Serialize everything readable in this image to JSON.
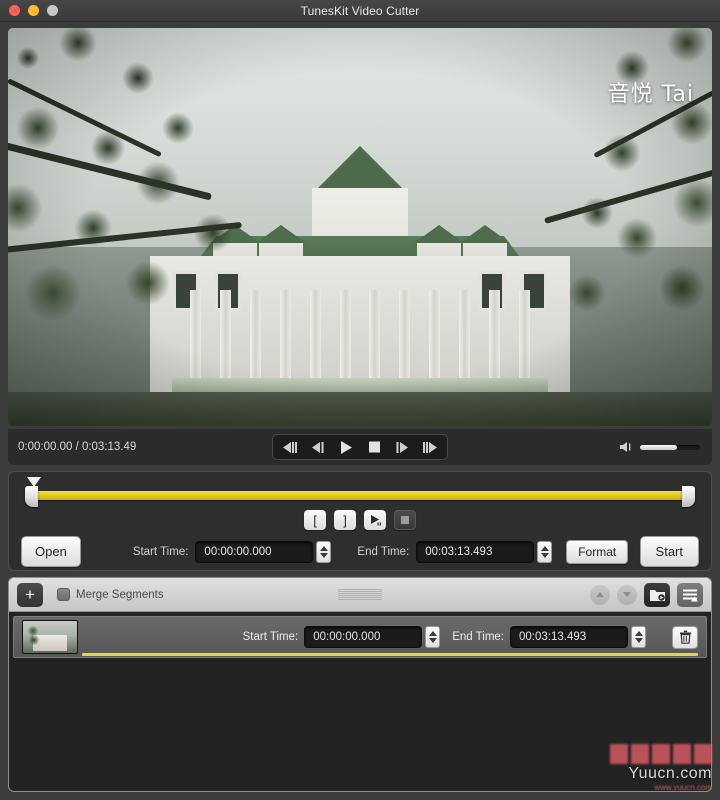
{
  "window": {
    "title": "TunesKit Video Cutter",
    "traffic_lights": [
      "close",
      "minimize",
      "zoom"
    ]
  },
  "video": {
    "watermark_logo": "音悦 Tai",
    "scene_description": "white clock-tower building framed by trees"
  },
  "player": {
    "time_readout": "0:00:00.00 / 0:03:13.49",
    "current_time": "0:00:00.00",
    "total_duration": "0:03:13.49",
    "transport": [
      {
        "name": "step-back-fast-button",
        "icon": "prev-frames-icon"
      },
      {
        "name": "step-back-button",
        "icon": "prev-frame-icon"
      },
      {
        "name": "play-button",
        "icon": "play-icon"
      },
      {
        "name": "stop-button",
        "icon": "stop-icon"
      },
      {
        "name": "step-forward-button",
        "icon": "next-frame-icon"
      },
      {
        "name": "step-forward-fast-button",
        "icon": "next-frames-icon"
      }
    ],
    "volume": {
      "icon": "volume-icon",
      "level_percent": 62
    }
  },
  "trim": {
    "playhead_position_percent": 0,
    "selection_start_percent": 0,
    "selection_end_percent": 100,
    "bar_color": "#e8cf1e",
    "mark_buttons": [
      {
        "name": "mark-in-button",
        "label": "["
      },
      {
        "name": "mark-out-button",
        "label": "]"
      },
      {
        "name": "preview-play-button",
        "label": "▶"
      },
      {
        "name": "preview-stop-button",
        "label": ""
      }
    ],
    "open_label": "Open",
    "start_time_label": "Start Time:",
    "start_time_value": "00:00:00.000",
    "end_time_label": "End Time:",
    "end_time_value": "00:03:13.493",
    "format_label": "Format",
    "start_label": "Start"
  },
  "segments_panel": {
    "add_label": "+",
    "merge_label": "Merge Segments",
    "merge_checked": false,
    "header_buttons": [
      {
        "name": "move-up-button",
        "icon": "chevron-up-icon"
      },
      {
        "name": "move-down-button",
        "icon": "chevron-down-icon"
      },
      {
        "name": "output-folder-button",
        "icon": "folder-icon"
      },
      {
        "name": "segment-list-button",
        "icon": "list-icon"
      }
    ],
    "rows": [
      {
        "thumbnail": "video-thumbnail",
        "start_time_label": "Start Time:",
        "start_time_value": "00:00:00.000",
        "end_time_label": "End Time:",
        "end_time_value": "00:03:13.493",
        "delete_icon": "trash-icon"
      }
    ]
  },
  "watermark": {
    "text": "Yuucn.com",
    "sub": "www.yuucn.com"
  }
}
